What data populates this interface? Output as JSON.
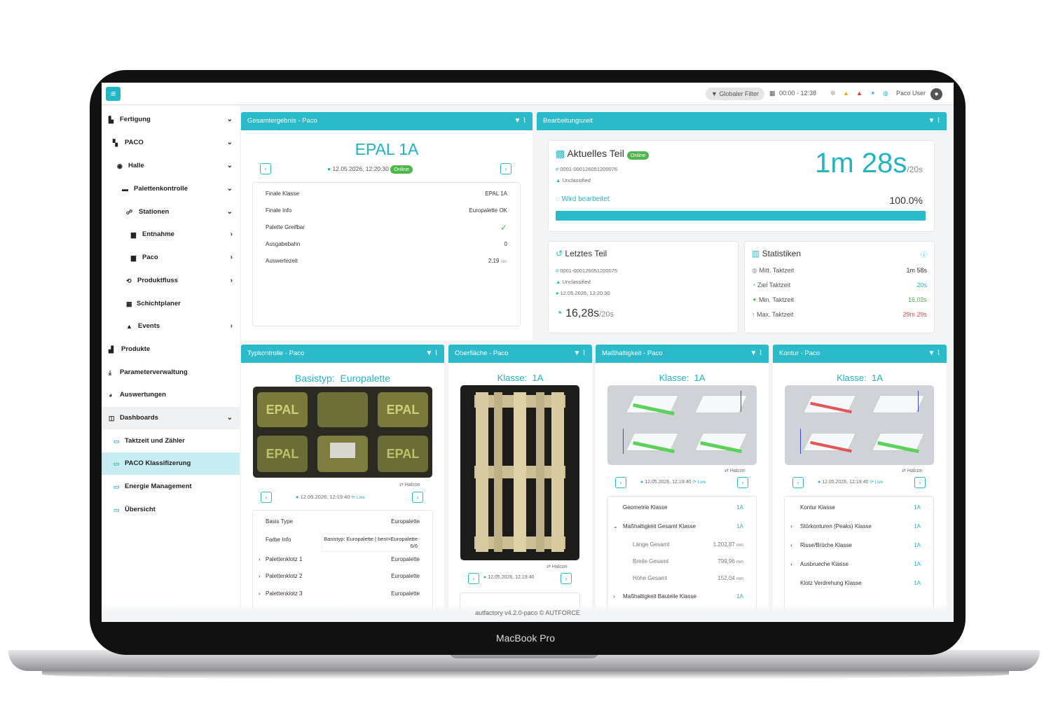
{
  "device": {
    "label": "MacBook Pro"
  },
  "topbar": {
    "filter_label": "Globaler Filter",
    "time_range": "00:00 - 12:38",
    "user_name": "Paco User"
  },
  "sidebar": {
    "items": [
      {
        "label": "Fertigung"
      },
      {
        "label": "PACO"
      },
      {
        "label": "Halle"
      },
      {
        "label": "Palettenkontrolle"
      },
      {
        "label": "Stationen"
      },
      {
        "label": "Entnahme"
      },
      {
        "label": "Paco"
      },
      {
        "label": "Produktfluss"
      },
      {
        "label": "Schichtplaner"
      },
      {
        "label": "Events"
      },
      {
        "label": "Produkte"
      },
      {
        "label": "Parameterverwaltung"
      },
      {
        "label": "Auswertungen"
      },
      {
        "label": "Dashboards"
      },
      {
        "label": "Taktzeit und Zähler"
      },
      {
        "label": "PACO Klassifizerung"
      },
      {
        "label": "Energie Management"
      },
      {
        "label": "Übersicht"
      }
    ]
  },
  "gesamt": {
    "header": "Gesamtergebnis - Paco",
    "title": "EPAL 1A",
    "datetime": "12.05.2026, 12:20:30",
    "status": "Online",
    "rows": [
      {
        "key": "Finale Klasse",
        "value": "EPAL 1A"
      },
      {
        "key": "Finale Info",
        "value": "Europalette OK"
      },
      {
        "key": "Palette Greifbar",
        "value": "✓"
      },
      {
        "key": "Ausgabebahn",
        "value": "0"
      },
      {
        "key": "Auswertezeit",
        "value": "2,19",
        "unit": "sec"
      }
    ]
  },
  "bearbeitung": {
    "header": "Bearbeitungszeit",
    "current_title": "Aktuelles Teil",
    "current_status": "Online",
    "current_id": "0001-000126051200076",
    "current_class": "Unclassified",
    "processing_label": "Wird bearbeitet",
    "time_big": "1m 28s",
    "time_target": "/20s",
    "progress_text": "100.0%",
    "progress": 1.0,
    "last_title": "Letztes Teil",
    "last_id": "0001-000126051200075",
    "last_class": "Unclassified",
    "last_datetime": "12.05.2026, 12:20:30",
    "last_time": "16,28s",
    "last_target": "/20s",
    "stats_title": "Statistiken",
    "stats": [
      {
        "label": "Mitt. Taktzeit",
        "value": "1m 58s",
        "color": "#333333"
      },
      {
        "label": "Ziel Taktzeit",
        "value": "20s",
        "color": "#23b4c4"
      },
      {
        "label": "Min. Taktzeit",
        "value": "16,02s",
        "color": "#4cb84a"
      },
      {
        "label": "Max. Taktzeit",
        "value": "29m 29s",
        "color": "#e04b4b"
      }
    ]
  },
  "typ": {
    "header": "Typkontrolle - Paco",
    "title_key": "Basistyp:",
    "title_value": "Europalette",
    "source": "Halcon",
    "datetime": "12.05.2026, 12:19:40",
    "live": "Live",
    "rows": [
      {
        "key": "Basis Type",
        "value": "Europalette"
      },
      {
        "key": "Farbe Info",
        "value": "Basistyp: Europalette | best=Europalette 6/6"
      },
      {
        "key": "Palettenklotz 1",
        "value": "Europalette"
      },
      {
        "key": "Palettenklotz 2",
        "value": "Europalette"
      },
      {
        "key": "Palettenklotz 3",
        "value": "Europalette"
      }
    ]
  },
  "ober": {
    "header": "Oberfläche - Paco",
    "title_key": "Klasse:",
    "title_value": "1A",
    "source": "Halcon",
    "datetime": "12.05.2026, 12:19:40"
  },
  "mass": {
    "header": "Maßhaltigkeit - Paco",
    "title_key": "Klasse:",
    "title_value": "1A",
    "source": "Halcon",
    "datetime": "12.05.2026, 12:19:40",
    "live": "Live",
    "rows": [
      {
        "key": "Geometrie Klasse",
        "value": "1A"
      },
      {
        "key": "Maßhaltigkeit Gesamt Klasse",
        "value": "1A"
      },
      {
        "key": "Länge Gesamt",
        "value": "1.202,87",
        "unit": "mm"
      },
      {
        "key": "Breite Gesamt",
        "value": "799,96",
        "unit": "mm"
      },
      {
        "key": "Höhe Gesamt",
        "value": "152,04",
        "unit": "mm"
      },
      {
        "key": "Maßhaltigkeit Bauteile Klasse",
        "value": "1A"
      }
    ]
  },
  "kontur": {
    "header": "Kontur - Paco",
    "title_key": "Klasse:",
    "title_value": "1A",
    "source": "Halcon",
    "datetime": "12.05.2026, 12:19:40",
    "live": "Live",
    "rows": [
      {
        "key": "Kontur Klasse",
        "value": "1A"
      },
      {
        "key": "Störkonturen (Peaks) Klasse",
        "value": "1A"
      },
      {
        "key": "Risse/Brüche Klasse",
        "value": "1A"
      },
      {
        "key": "Ausbrueche Klasse",
        "value": "1A"
      },
      {
        "key": "Klotz Verdrehung Klasse",
        "value": "1A"
      }
    ]
  },
  "photo_labels": {
    "epal": "EPAL"
  },
  "footer": "autfactory v4.2.0-paco © AUTFORCE"
}
